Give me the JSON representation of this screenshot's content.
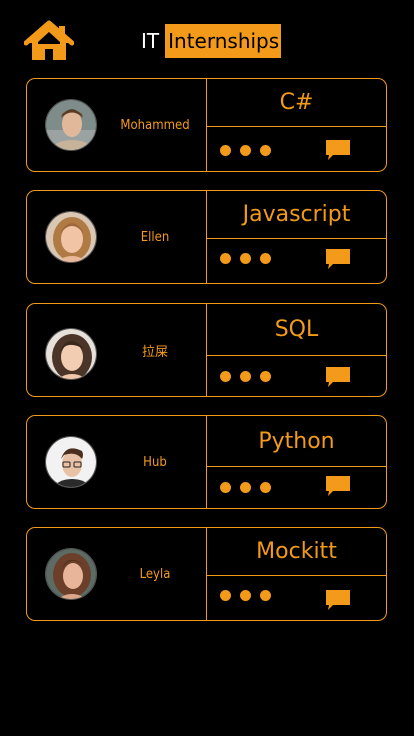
{
  "header": {
    "title_prefix": "IT",
    "title_main": "Internships",
    "home_icon": "home-icon"
  },
  "colors": {
    "accent": "#F39A1A",
    "background": "#000000",
    "title_prefix": "#FFFFFF"
  },
  "cards": [
    {
      "name": "Mohammed",
      "skill": "C#",
      "more_icon": "more-dots-icon",
      "message_icon": "chat-bubble-icon"
    },
    {
      "name": "Ellen",
      "skill": "Javascript",
      "more_icon": "more-dots-icon",
      "message_icon": "chat-bubble-icon"
    },
    {
      "name": "拉屎",
      "skill": "SQL",
      "more_icon": "more-dots-icon",
      "message_icon": "chat-bubble-icon"
    },
    {
      "name": "Hub",
      "skill": "Python",
      "more_icon": "more-dots-icon",
      "message_icon": "chat-bubble-icon"
    },
    {
      "name": "Leyla",
      "skill": "Mockitt",
      "more_icon": "more-dots-icon",
      "message_icon": "chat-bubble-icon"
    }
  ]
}
